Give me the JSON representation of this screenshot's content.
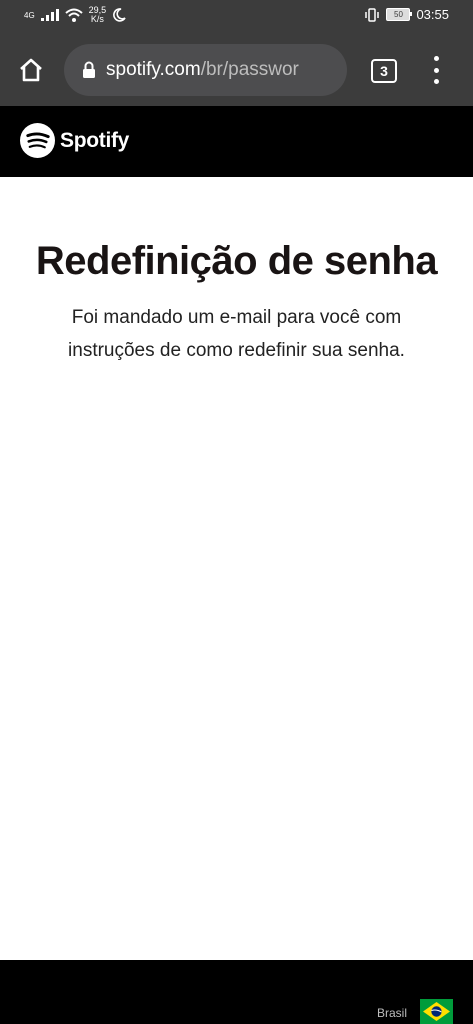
{
  "status_bar": {
    "network": "4G",
    "speed_value": "29,5",
    "speed_unit": "K/s",
    "battery": "50",
    "time": "03:55"
  },
  "browser": {
    "url_host": "spotify.com",
    "url_path": "/br/passwor",
    "tab_count": "3"
  },
  "header": {
    "logo_text": "Spotify"
  },
  "main": {
    "title": "Redefinição de senha",
    "message": "Foi mandado um e-mail para você com instruções de como redefinir sua senha."
  },
  "footer": {
    "country": "Brasil"
  }
}
